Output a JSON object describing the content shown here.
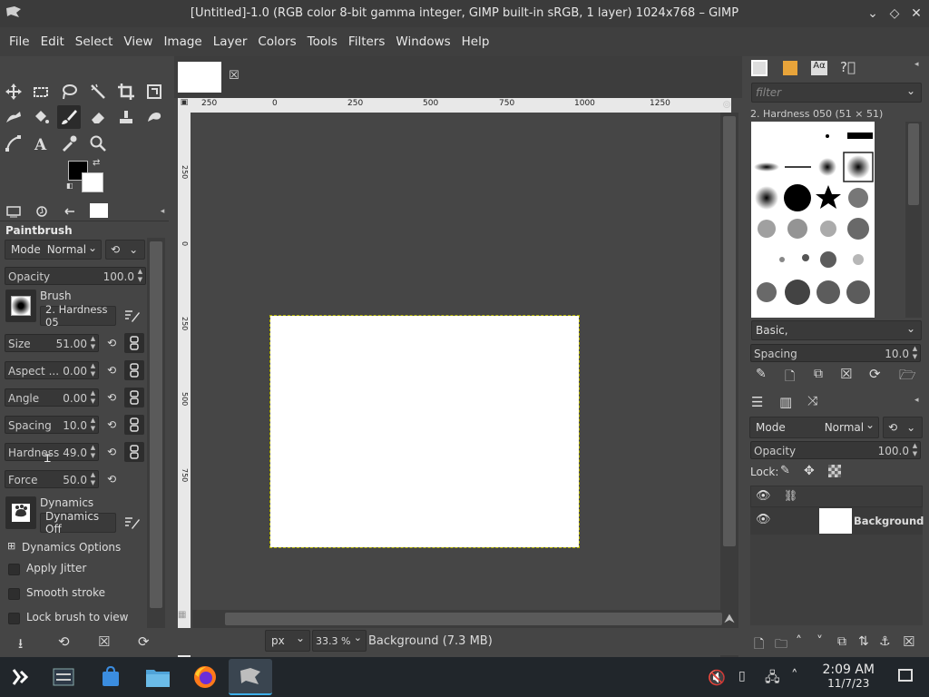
{
  "window": {
    "title": "[Untitled]-1.0 (RGB color 8-bit gamma integer, GIMP built-in sRGB, 1 layer) 1024x768 – GIMP"
  },
  "menu": [
    "File",
    "Edit",
    "Select",
    "View",
    "Image",
    "Layer",
    "Colors",
    "Tools",
    "Filters",
    "Windows",
    "Help"
  ],
  "tool_options": {
    "title": "Paintbrush",
    "mode_label": "Mode",
    "mode_value": "Normal",
    "opacity_label": "Opacity",
    "opacity_value": "100.0",
    "brush_label": "Brush",
    "brush_value": "2. Hardness 05",
    "sliders": [
      {
        "label": "Size",
        "value": "51.00"
      },
      {
        "label": "Aspect ...",
        "value": "0.00"
      },
      {
        "label": "Angle",
        "value": "0.00"
      },
      {
        "label": "Spacing",
        "value": "10.0"
      },
      {
        "label": "Hardness",
        "value": "49.0"
      },
      {
        "label": "Force",
        "value": "50.0"
      }
    ],
    "dynamics_label": "Dynamics",
    "dynamics_value": "Dynamics Off",
    "dynamics_options": "Dynamics Options",
    "checks": [
      "Apply Jitter",
      "Smooth stroke",
      "Lock brush to view"
    ]
  },
  "rulers": {
    "h_ticks": [
      "250",
      "0",
      "250",
      "500",
      "750",
      "1000",
      "1250"
    ],
    "v_ticks": [
      "250",
      "0",
      "250",
      "500",
      "750"
    ]
  },
  "status": {
    "unit": "px",
    "zoom": "33.3 %",
    "info": "Background (7.3 MB)"
  },
  "brushes": {
    "filter_placeholder": "filter",
    "current": "2. Hardness 050 (51 × 51)",
    "tag": "Basic,",
    "spacing_label": "Spacing",
    "spacing_value": "10.0"
  },
  "layers": {
    "mode_label": "Mode",
    "mode_value": "Normal",
    "opacity_label": "Opacity",
    "opacity_value": "100.0",
    "lock_label": "Lock:",
    "layer_name": "Background"
  },
  "taskbar": {
    "time": "2:09 AM",
    "date": "11/7/23"
  }
}
